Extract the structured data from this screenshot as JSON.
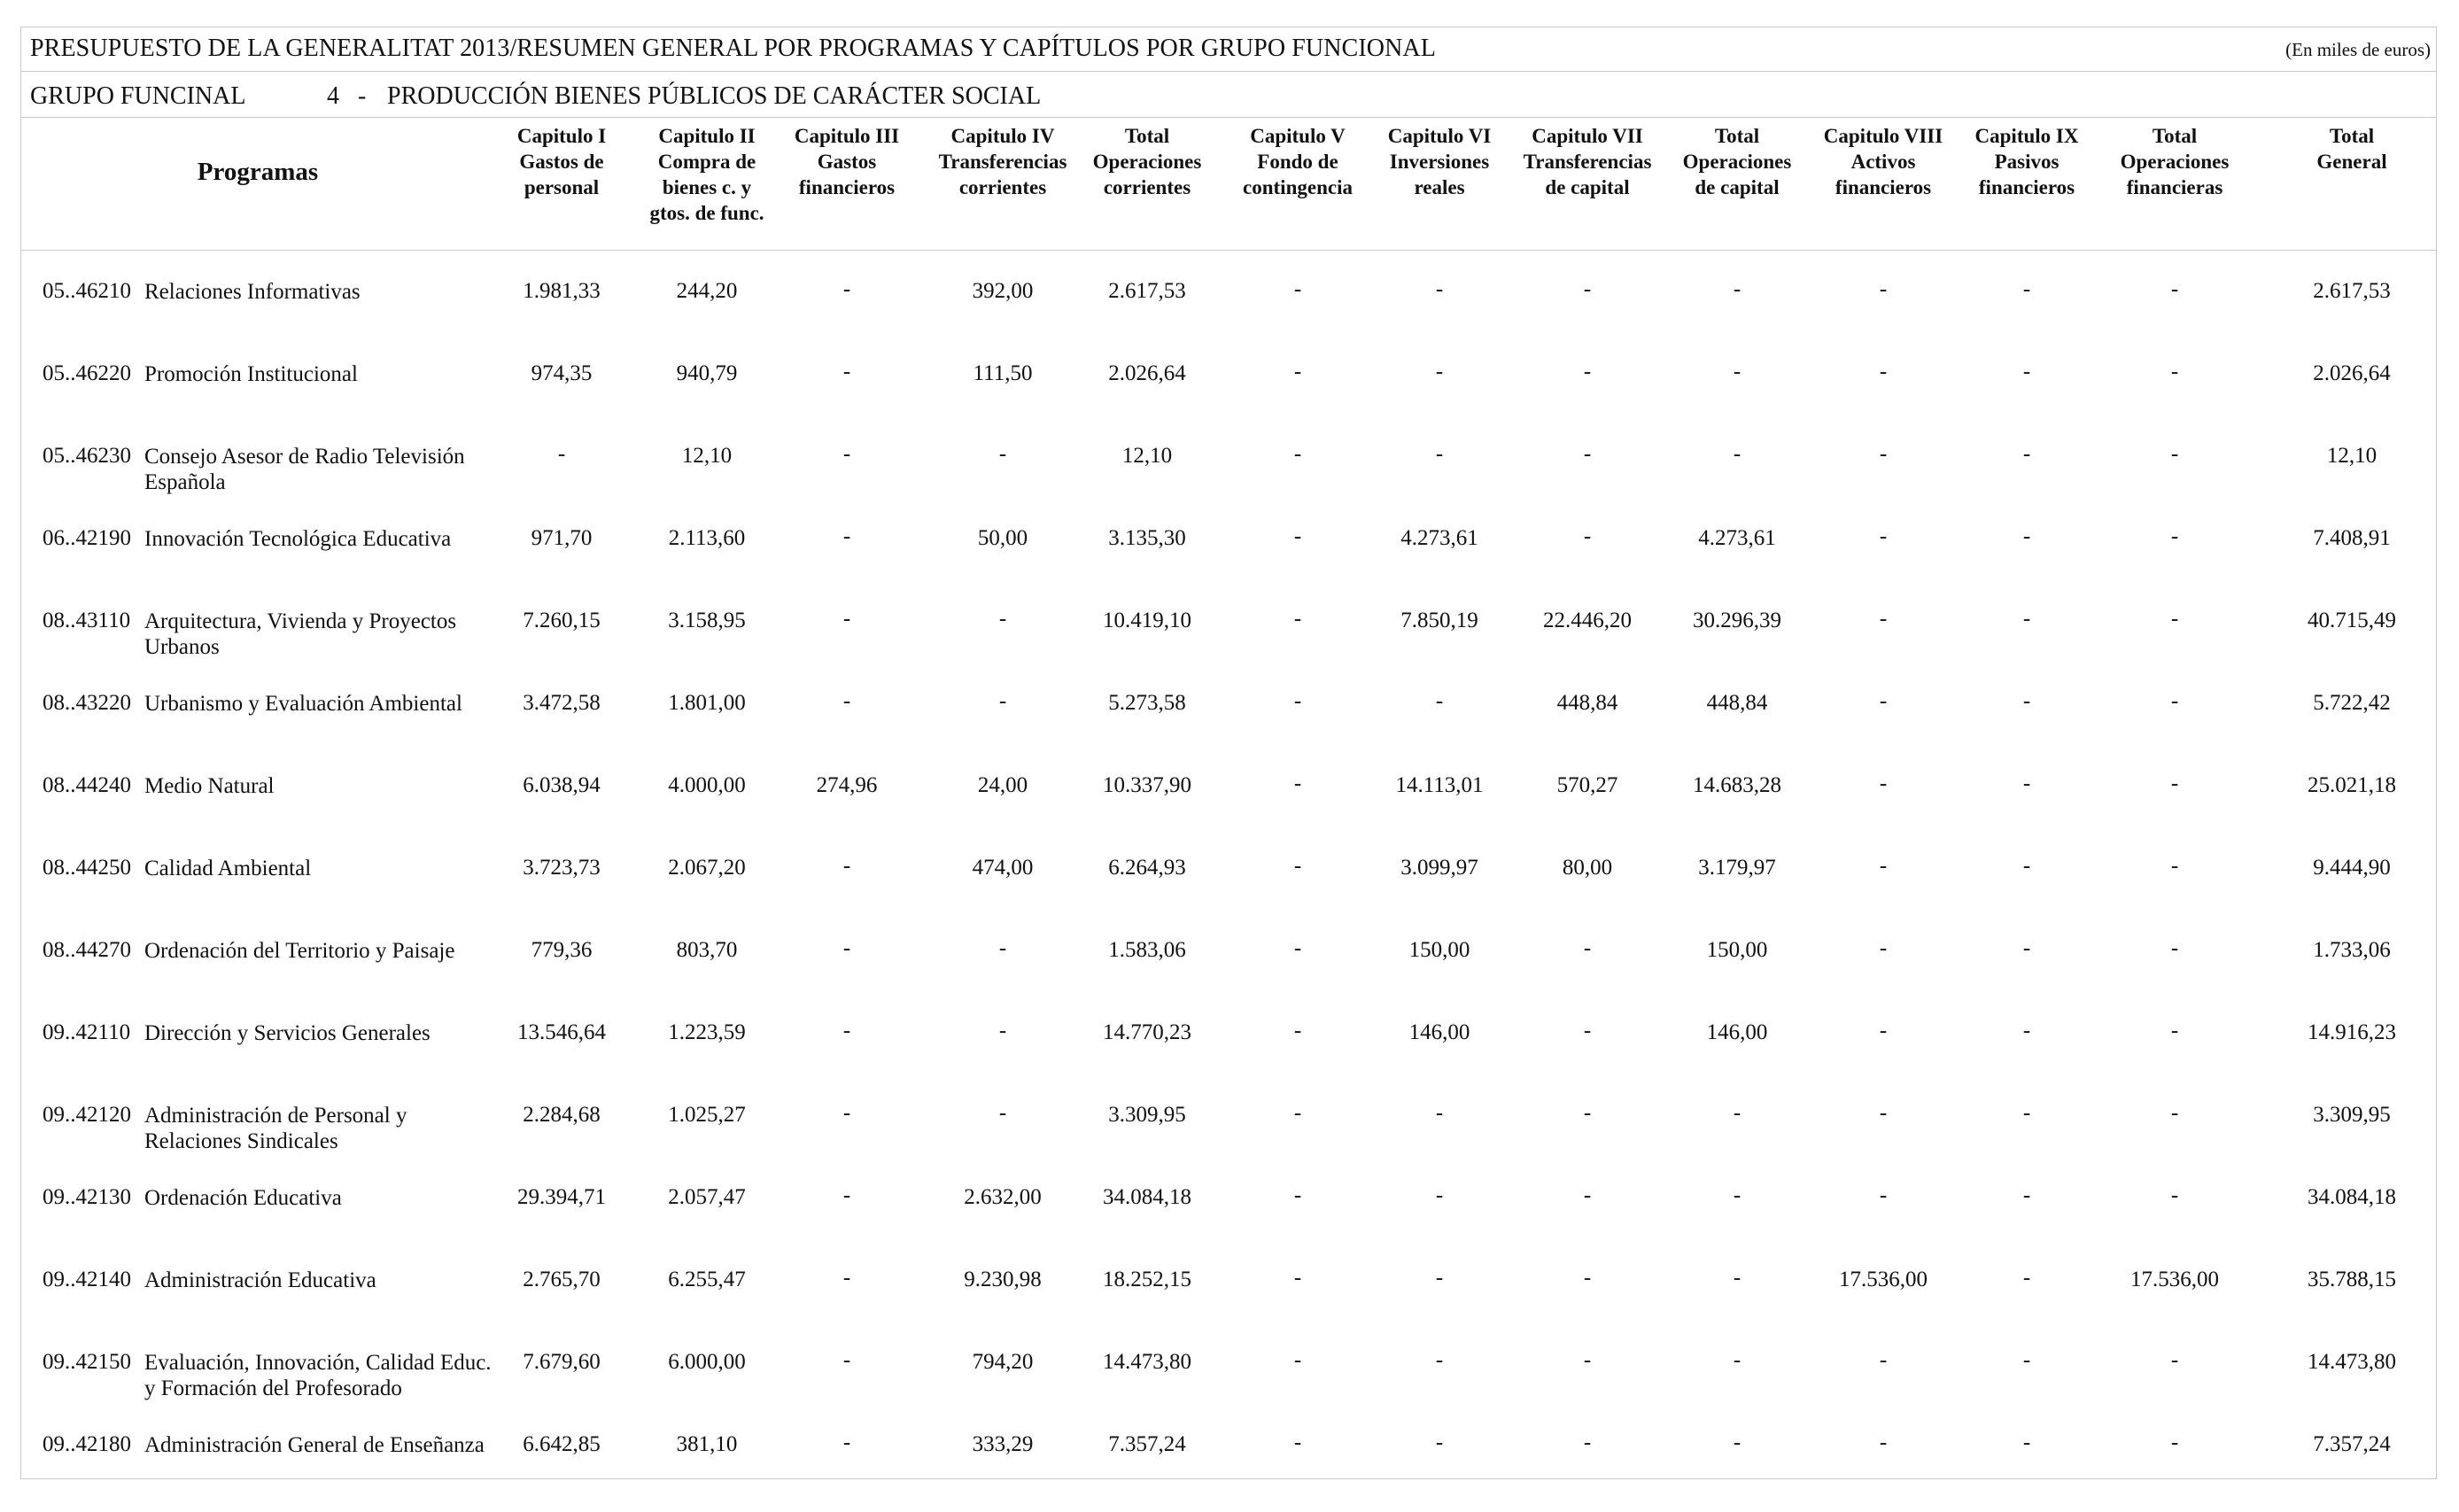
{
  "header": {
    "title": "PRESUPUESTO DE LA GENERALITAT 2013/RESUMEN GENERAL POR PROGRAMAS Y CAPÍTULOS POR GRUPO FUNCIONAL",
    "units": "(En miles de euros)"
  },
  "group": {
    "label": "GRUPO FUNCINAL",
    "number": "4",
    "dash": "-",
    "name": "PRODUCCIÓN BIENES PÚBLICOS DE CARÁCTER SOCIAL"
  },
  "table": {
    "programs_header": "Programas",
    "columns": [
      "Capitulo I\nGastos de\npersonal",
      "Capitulo II\nCompra de\nbienes c. y\ngtos. de func.",
      "Capitulo III\nGastos\nfinancieros",
      "Capitulo IV\nTransferencias\ncorrientes",
      "Total\nOperaciones\ncorrientes",
      "Capitulo V\nFondo de\ncontingencia",
      "Capitulo VI\nInversiones\nreales",
      "Capitulo VII\nTransferencias\nde capital",
      "Total\nOperaciones\nde capital",
      "Capitulo VIII\nActivos\nfinancieros",
      "Capitulo IX\nPasivos\nfinancieros",
      "Total\nOperaciones\nfinancieras",
      "Total General"
    ],
    "rows": [
      {
        "code": "05..46210",
        "name": "Relaciones Informativas",
        "values": [
          "1.981,33",
          "244,20",
          "-",
          "392,00",
          "2.617,53",
          "-",
          "-",
          "-",
          "-",
          "-",
          "-",
          "-",
          "2.617,53"
        ]
      },
      {
        "code": "05..46220",
        "name": "Promoción Institucional",
        "values": [
          "974,35",
          "940,79",
          "-",
          "111,50",
          "2.026,64",
          "-",
          "-",
          "-",
          "-",
          "-",
          "-",
          "-",
          "2.026,64"
        ]
      },
      {
        "code": "05..46230",
        "name": "Consejo Asesor de Radio Televisión Española",
        "values": [
          "-",
          "12,10",
          "-",
          "-",
          "12,10",
          "-",
          "-",
          "-",
          "-",
          "-",
          "-",
          "-",
          "12,10"
        ]
      },
      {
        "code": "06..42190",
        "name": "Innovación Tecnológica Educativa",
        "values": [
          "971,70",
          "2.113,60",
          "-",
          "50,00",
          "3.135,30",
          "-",
          "4.273,61",
          "-",
          "4.273,61",
          "-",
          "-",
          "-",
          "7.408,91"
        ]
      },
      {
        "code": "08..43110",
        "name": "Arquitectura, Vivienda y Proyectos Urbanos",
        "values": [
          "7.260,15",
          "3.158,95",
          "-",
          "-",
          "10.419,10",
          "-",
          "7.850,19",
          "22.446,20",
          "30.296,39",
          "-",
          "-",
          "-",
          "40.715,49"
        ]
      },
      {
        "code": "08..43220",
        "name": "Urbanismo y Evaluación Ambiental",
        "values": [
          "3.472,58",
          "1.801,00",
          "-",
          "-",
          "5.273,58",
          "-",
          "-",
          "448,84",
          "448,84",
          "-",
          "-",
          "-",
          "5.722,42"
        ]
      },
      {
        "code": "08..44240",
        "name": "Medio Natural",
        "values": [
          "6.038,94",
          "4.000,00",
          "274,96",
          "24,00",
          "10.337,90",
          "-",
          "14.113,01",
          "570,27",
          "14.683,28",
          "-",
          "-",
          "-",
          "25.021,18"
        ]
      },
      {
        "code": "08..44250",
        "name": "Calidad Ambiental",
        "values": [
          "3.723,73",
          "2.067,20",
          "-",
          "474,00",
          "6.264,93",
          "-",
          "3.099,97",
          "80,00",
          "3.179,97",
          "-",
          "-",
          "-",
          "9.444,90"
        ]
      },
      {
        "code": "08..44270",
        "name": "Ordenación del Territorio y Paisaje",
        "values": [
          "779,36",
          "803,70",
          "-",
          "-",
          "1.583,06",
          "-",
          "150,00",
          "-",
          "150,00",
          "-",
          "-",
          "-",
          "1.733,06"
        ]
      },
      {
        "code": "09..42110",
        "name": "Dirección y Servicios Generales",
        "values": [
          "13.546,64",
          "1.223,59",
          "-",
          "-",
          "14.770,23",
          "-",
          "146,00",
          "-",
          "146,00",
          "-",
          "-",
          "-",
          "14.916,23"
        ]
      },
      {
        "code": "09..42120",
        "name": "Administración de Personal y Relaciones Sindicales",
        "values": [
          "2.284,68",
          "1.025,27",
          "-",
          "-",
          "3.309,95",
          "-",
          "-",
          "-",
          "-",
          "-",
          "-",
          "-",
          "3.309,95"
        ]
      },
      {
        "code": "09..42130",
        "name": "Ordenación Educativa",
        "values": [
          "29.394,71",
          "2.057,47",
          "-",
          "2.632,00",
          "34.084,18",
          "-",
          "-",
          "-",
          "-",
          "-",
          "-",
          "-",
          "34.084,18"
        ]
      },
      {
        "code": "09..42140",
        "name": "Administración Educativa",
        "values": [
          "2.765,70",
          "6.255,47",
          "-",
          "9.230,98",
          "18.252,15",
          "-",
          "-",
          "-",
          "-",
          "17.536,00",
          "-",
          "17.536,00",
          "35.788,15"
        ]
      },
      {
        "code": "09..42150",
        "name": "Evaluación, Innovación, Calidad Educ. y Formación del Profesorado",
        "values": [
          "7.679,60",
          "6.000,00",
          "-",
          "794,20",
          "14.473,80",
          "-",
          "-",
          "-",
          "-",
          "-",
          "-",
          "-",
          "14.473,80"
        ]
      },
      {
        "code": "09..42180",
        "name": "Administración General de Enseñanza",
        "values": [
          "6.642,85",
          "381,10",
          "-",
          "333,29",
          "7.357,24",
          "-",
          "-",
          "-",
          "-",
          "-",
          "-",
          "-",
          "7.357,24"
        ]
      }
    ]
  }
}
